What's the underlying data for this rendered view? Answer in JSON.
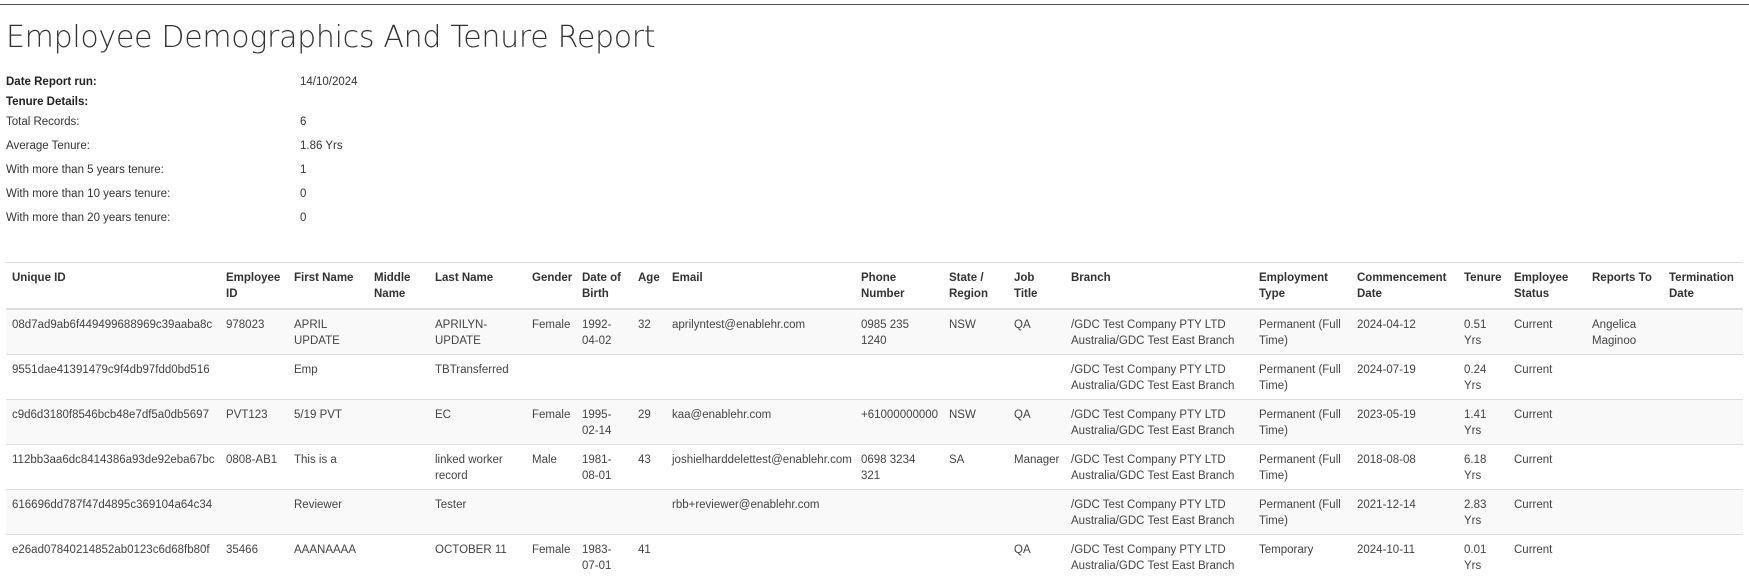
{
  "report": {
    "title": "Employee Demographics And Tenure Report",
    "summary": [
      {
        "label": "Date Report run:",
        "value": "14/10/2024",
        "bold": true
      },
      {
        "label": "Tenure Details:",
        "value": "",
        "bold": true
      },
      {
        "label": "Total Records:",
        "value": "6",
        "bold": false
      },
      {
        "label": "Average Tenure:",
        "value": "1.86 Yrs",
        "bold": false
      },
      {
        "label": "With more than 5 years tenure:",
        "value": "1",
        "bold": false
      },
      {
        "label": "With more than 10 years tenure:",
        "value": "0",
        "bold": false
      },
      {
        "label": "With more than 20 years tenure:",
        "value": "0",
        "bold": false
      }
    ]
  },
  "table": {
    "columns": [
      "Unique ID",
      "Employee ID",
      "First Name",
      "Middle Name",
      "Last Name",
      "Gender",
      "Date of Birth",
      "Age",
      "Email",
      "Phone Number",
      "State / Region",
      "Job Title",
      "Branch",
      "Employment Type",
      "Commencement Date",
      "Tenure",
      "Employee Status",
      "Reports To",
      "Termination Date"
    ],
    "rows": [
      [
        "08d7ad9ab6f449499688969c39aaba8c",
        "978023",
        "APRIL UPDATE",
        "",
        "APRILYN-UPDATE",
        "Female",
        "1992-04-02",
        "32",
        "aprilyntest@enablehr.com",
        "0985 235 1240",
        "NSW",
        "QA",
        "/GDC Test Company PTY LTD Australia/GDC Test East Branch",
        "Permanent (Full Time)",
        "2024-04-12",
        "0.51 Yrs",
        "Current",
        "Angelica Maginoo",
        ""
      ],
      [
        "9551dae41391479c9f4db97fdd0bd516",
        "",
        "Emp",
        "",
        "TBTransferred",
        "",
        "",
        "",
        "",
        "",
        "",
        "",
        "/GDC Test Company PTY LTD Australia/GDC Test East Branch",
        "Permanent (Full Time)",
        "2024-07-19",
        "0.24 Yrs",
        "Current",
        "",
        ""
      ],
      [
        "c9d6d3180f8546bcb48e7df5a0db5697",
        "PVT123",
        "5/19 PVT",
        "",
        "EC",
        "Female",
        "1995-02-14",
        "29",
        "kaa@enablehr.com",
        "+61000000000",
        "NSW",
        "QA",
        "/GDC Test Company PTY LTD Australia/GDC Test East Branch",
        "Permanent (Full Time)",
        "2023-05-19",
        "1.41 Yrs",
        "Current",
        "",
        ""
      ],
      [
        "112bb3aa6dc8414386a93de92eba67bc",
        "0808-AB1",
        "This is a",
        "",
        "linked worker record",
        "Male",
        "1981-08-01",
        "43",
        "joshielharddelettest@enablehr.com",
        "0698 3234 321",
        "SA",
        "Manager",
        "/GDC Test Company PTY LTD Australia/GDC Test East Branch",
        "Permanent (Full Time)",
        "2018-08-08",
        "6.18 Yrs",
        "Current",
        "",
        ""
      ],
      [
        "616696dd787f47d4895c369104a64c34",
        "",
        "Reviewer",
        "",
        "Tester",
        "",
        "",
        "",
        "rbb+reviewer@enablehr.com",
        "",
        "",
        "",
        "/GDC Test Company PTY LTD Australia/GDC Test East Branch",
        "Permanent (Full Time)",
        "2021-12-14",
        "2.83 Yrs",
        "Current",
        "",
        ""
      ],
      [
        "e26ad07840214852ab0123c6d68fb80f",
        "35466",
        "AAANAAAA",
        "",
        "OCTOBER 11",
        "Female",
        "1983-07-01",
        "41",
        "",
        "",
        "",
        "QA",
        "/GDC Test Company PTY LTD Australia/GDC Test East Branch",
        "Temporary",
        "2024-10-11",
        "0.01 Yrs",
        "Current",
        "",
        ""
      ]
    ]
  }
}
